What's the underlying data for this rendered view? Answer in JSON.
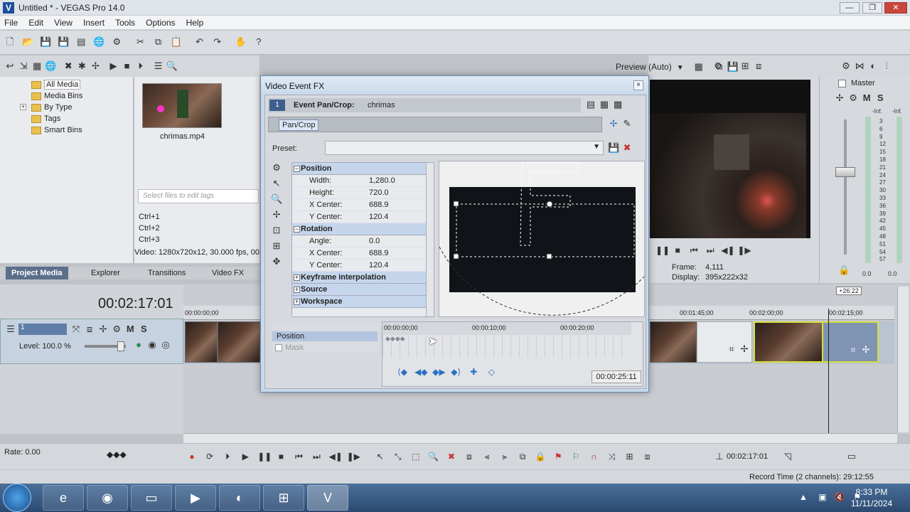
{
  "window": {
    "title": "Untitled * - VEGAS Pro 14.0",
    "app_icon": "V"
  },
  "menu": [
    "File",
    "Edit",
    "View",
    "Insert",
    "Tools",
    "Options",
    "Help"
  ],
  "explorer": {
    "tree": [
      {
        "label": "All Media",
        "selected": true
      },
      {
        "label": "Media Bins"
      },
      {
        "label": "By Type",
        "expandable": true
      },
      {
        "label": "Tags"
      },
      {
        "label": "Smart Bins"
      }
    ],
    "media_file": "chrimas.mp4",
    "tag_placeholder": "Select files to edit tags",
    "shortcuts": [
      "Ctrl+1",
      "Ctrl+2",
      "Ctrl+3"
    ],
    "status": "Video: 1280x720x12, 30.000 fps, 00"
  },
  "tabs": [
    {
      "label": "Project Media",
      "active": true
    },
    {
      "label": "Explorer"
    },
    {
      "label": "Transitions"
    },
    {
      "label": "Video FX"
    }
  ],
  "preview": {
    "mode": "Preview (Auto)",
    "frame_label": "Frame:",
    "frame_value": "4,111",
    "display_label": "Display:",
    "display_value": "395x222x32"
  },
  "master": {
    "label": "Master",
    "buttons": [
      "M",
      "S"
    ],
    "left_db": "-Inf.",
    "right_db": "-Inf.",
    "scale": [
      "3",
      "6",
      "9",
      "12",
      "15",
      "18",
      "21",
      "24",
      "27",
      "30",
      "33",
      "36",
      "39",
      "42",
      "45",
      "48",
      "51",
      "54",
      "57"
    ],
    "bottom_left": "0.0",
    "bottom_right": "0.0"
  },
  "timeline": {
    "timecode": "00:02:17:01",
    "track_number": "1",
    "track_buttons": [
      "M",
      "S"
    ],
    "level_label": "Level: 100.0 %",
    "level_value": 1.0,
    "ruler": [
      "00:00:00;00",
      "00:01:45;00",
      "00:02:00;00",
      "00:02:15;00"
    ],
    "region_mark": "+26:22"
  },
  "transport": {
    "rate": "Rate: 0.00",
    "end_time": "00:02:17:01"
  },
  "status": {
    "record_time": "Record Time (2 channels): 29:12:55"
  },
  "taskbar": {
    "time": "8:33 PM",
    "date": "11/11/2024"
  },
  "dialog": {
    "title": "Video Event FX",
    "close": "×",
    "fx_number": "1",
    "fx_label": "Event Pan/Crop:",
    "fx_value": "chrimas",
    "plugin": "Pan/Crop",
    "preset_label": "Preset:",
    "sections": {
      "position": {
        "title": "Position",
        "rows": [
          {
            "k": "Width:",
            "v": "1,280.0"
          },
          {
            "k": "Height:",
            "v": "720.0"
          },
          {
            "k": "X Center:",
            "v": "688.9"
          },
          {
            "k": "Y Center:",
            "v": "120.4"
          }
        ]
      },
      "rotation": {
        "title": "Rotation",
        "rows": [
          {
            "k": "Angle:",
            "v": "0.0"
          },
          {
            "k": "X Center:",
            "v": "688.9"
          },
          {
            "k": "Y Center:",
            "v": "120.4"
          }
        ]
      },
      "collapsed": [
        "Keyframe interpolation",
        "Source",
        "Workspace"
      ]
    },
    "keyframes": {
      "row_position": "Position",
      "row_mask": "Mask",
      "ruler": [
        "00:00:00;00",
        "00:00:10;00",
        "00:00:20;00"
      ],
      "time": "00:00:25:11"
    }
  }
}
